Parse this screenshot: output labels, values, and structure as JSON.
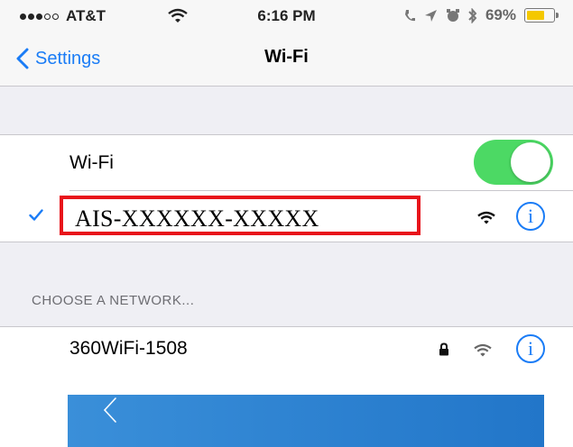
{
  "status_bar": {
    "carrier": "AT&T",
    "time": "6:16 PM",
    "battery_percent": "69%",
    "battery_level": 0.69,
    "signal_bars_filled": 3,
    "signal_bars_total": 5
  },
  "nav": {
    "back_label": "Settings",
    "title": "Wi-Fi"
  },
  "wifi_toggle": {
    "label": "Wi-Fi",
    "on": true
  },
  "connected_network": {
    "name": "AIS-XXXXXX-XXXXX",
    "connected": true
  },
  "section_header": "CHOOSE A NETWORK...",
  "networks": [
    {
      "name": "360WiFi-1508",
      "locked": true
    }
  ],
  "icons": {
    "back": "chevron-left-icon",
    "checkmark": "checkmark-icon",
    "wifi": "wifi-icon",
    "info": "info-icon",
    "lock": "lock-icon"
  },
  "colors": {
    "accent": "#1a7cf6",
    "toggle_on": "#4cd964",
    "highlight_border": "#e8141b",
    "battery_fill": "#f4c800",
    "banner": "#2a7fd0"
  }
}
